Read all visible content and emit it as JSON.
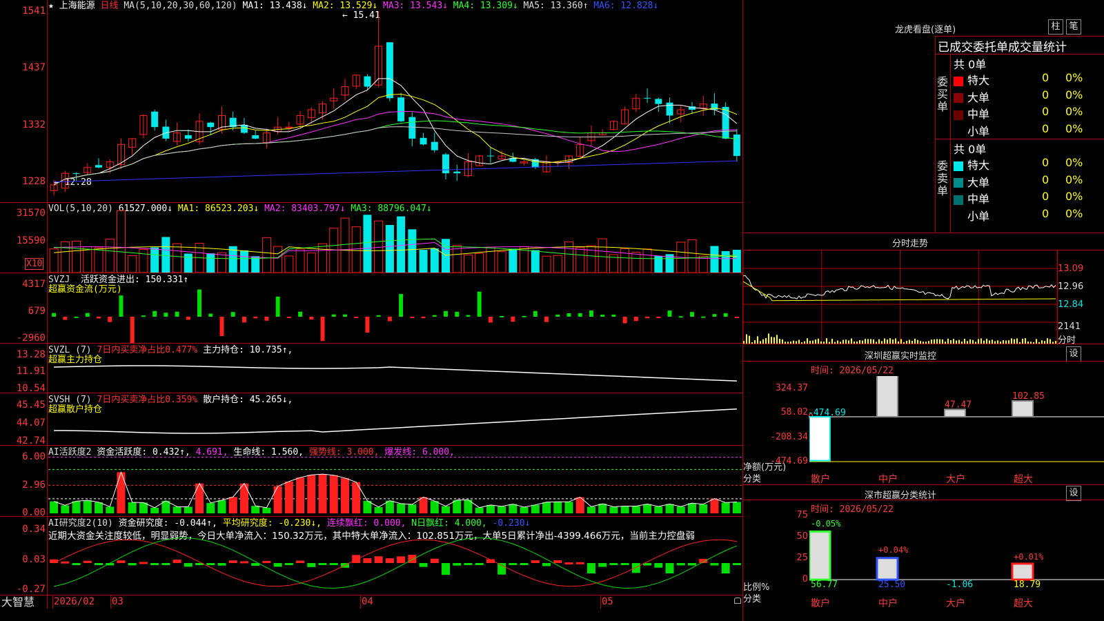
{
  "colors": {
    "up": "#ff2020",
    "down": "#00e8e8",
    "grid": "#b00000",
    "ma1": "#ffffff",
    "ma2": "#ffff00",
    "ma3": "#ff33ff",
    "ma4": "#33ff33",
    "ma5": "#c8c8c8",
    "ma6": "#3333ff",
    "green": "#00dd00"
  },
  "main": {
    "star": "★",
    "stock_name": "上海能源",
    "period": "日线",
    "ma_label": "MA(5,10,20,30,60,120)",
    "ma1": "MA1: 13.438↓",
    "ma2": "MA2: 13.529↓",
    "ma3": "MA3: 13.543↓",
    "ma4": "MA4: 13.309↓",
    "ma5": "MA5: 13.360↑",
    "ma6": "MA6: 12.828↓",
    "high_mark": "15.41",
    "low_mark": "12.28",
    "axis": [
      "1541",
      "1437",
      "1332",
      "1228"
    ]
  },
  "vol": {
    "label": "VOL(5,10,20)",
    "value": "61527.000↓",
    "ma1": "MA1: 86523.203↓",
    "ma2": "MA2: 83403.797↓",
    "ma3": "MA3: 88796.047↓",
    "axis": [
      "31570",
      "15590"
    ],
    "unit": "X10"
  },
  "svzj": {
    "label": "SVZJ",
    "text1": "活跃资金进出: 150.331↑",
    "text2": "超赢资金流(万元)",
    "axis": [
      "4317",
      "679",
      "-2960"
    ]
  },
  "svzl": {
    "label": "SVZL (7)",
    "text1": "7日内买卖净占比0.477%",
    "text2": "主力持仓: 10.735↑,",
    "text3": "超赢主力持仓",
    "axis": [
      "13.28",
      "11.91",
      "10.54"
    ]
  },
  "svsh": {
    "label": "SVSH (7)",
    "text1": "7日内买卖净占比0.359%",
    "text2": "散户持仓: 45.265↓,",
    "text3": "超赢散户持仓",
    "axis": [
      "45.45",
      "44.07",
      "42.74"
    ]
  },
  "ai1": {
    "label": "AI活跃度2",
    "text1": "资金活跃度: 0.432↑,",
    "text2": "4.691,",
    "text3": "生命线: 1.560,",
    "text4": "强势线: 3.000,",
    "text5": "爆发线: 6.000,",
    "axis": [
      "6.00",
      "2.96",
      "0.00"
    ]
  },
  "ai2": {
    "label": "AI研究度2(10)",
    "text1": "资金研究度: -0.044↑,",
    "text2": "平均研究度: -0.230↓,",
    "text3": "连续飘红: 0.000,",
    "text4": "N日飘红: 4.000,",
    "text5": "-0.230↓",
    "note": "近期大资金关注度较低，明显弱势，今日大单净流入：150.32万元，其中特大单净流入：102.851万元，大单5日累计净出-4399.466万元，当前主力控盘弱",
    "axis": [
      "0.34",
      "0.03",
      "-0.27"
    ]
  },
  "bottom": {
    "brand": "大智慧",
    "dates": [
      "2026/02",
      "03",
      "04",
      "05"
    ]
  },
  "right": {
    "lhb_title": "龙虎看盘(逐单)",
    "btn_zhu": "柱",
    "btn_bi": "笔",
    "stat_title": "已成交委托单成交量统计",
    "buy_side": "委买单",
    "sell_side": "委卖单",
    "buy_total": "共 0单",
    "sell_total": "共 0单",
    "buy_rows": [
      {
        "name": "特大",
        "n": "0",
        "p": "0%"
      },
      {
        "name": "大单",
        "n": "0",
        "p": "0%"
      },
      {
        "name": "中单",
        "n": "0",
        "p": "0%"
      },
      {
        "name": "小单",
        "n": "0",
        "p": "0%"
      }
    ],
    "sell_rows": [
      {
        "name": "特大",
        "n": "0",
        "p": "0%"
      },
      {
        "name": "大单",
        "n": "0",
        "p": "0%"
      },
      {
        "name": "中单",
        "n": "0",
        "p": "0%"
      },
      {
        "name": "小单",
        "n": "0",
        "p": "0%"
      }
    ],
    "fs_title": "分时走势",
    "fs_axis": [
      "13.09",
      "12.96",
      "12.84",
      "2141",
      "分时"
    ],
    "sz_title": "深圳超赢实时监控",
    "sz_btn": "设",
    "sz_time": "时间: 2026/05/22",
    "sz_axis": [
      "324.37",
      "58.02",
      "0",
      "-208.34",
      "-474.69"
    ],
    "sz_values": [
      "-474.69",
      "324.37",
      "47.47",
      "102.85"
    ],
    "sz_unit": "净额(万元)",
    "sz_cat": "分类",
    "cats": [
      "散户",
      "中户",
      "大户",
      "超大"
    ],
    "fl_title": "深市超赢分类统计",
    "fl_btn": "设",
    "fl_time": "时间: 2026/05/22",
    "fl_axis": [
      "75",
      "50",
      "25",
      "0"
    ],
    "fl_top": [
      "-0.05%",
      "+0.04%",
      "+0.01%"
    ],
    "fl_bottom": [
      "56.77",
      "25.50",
      "-1.06",
      "18.79"
    ],
    "fl_unit": "比例%",
    "fl_cat": "分类"
  }
}
